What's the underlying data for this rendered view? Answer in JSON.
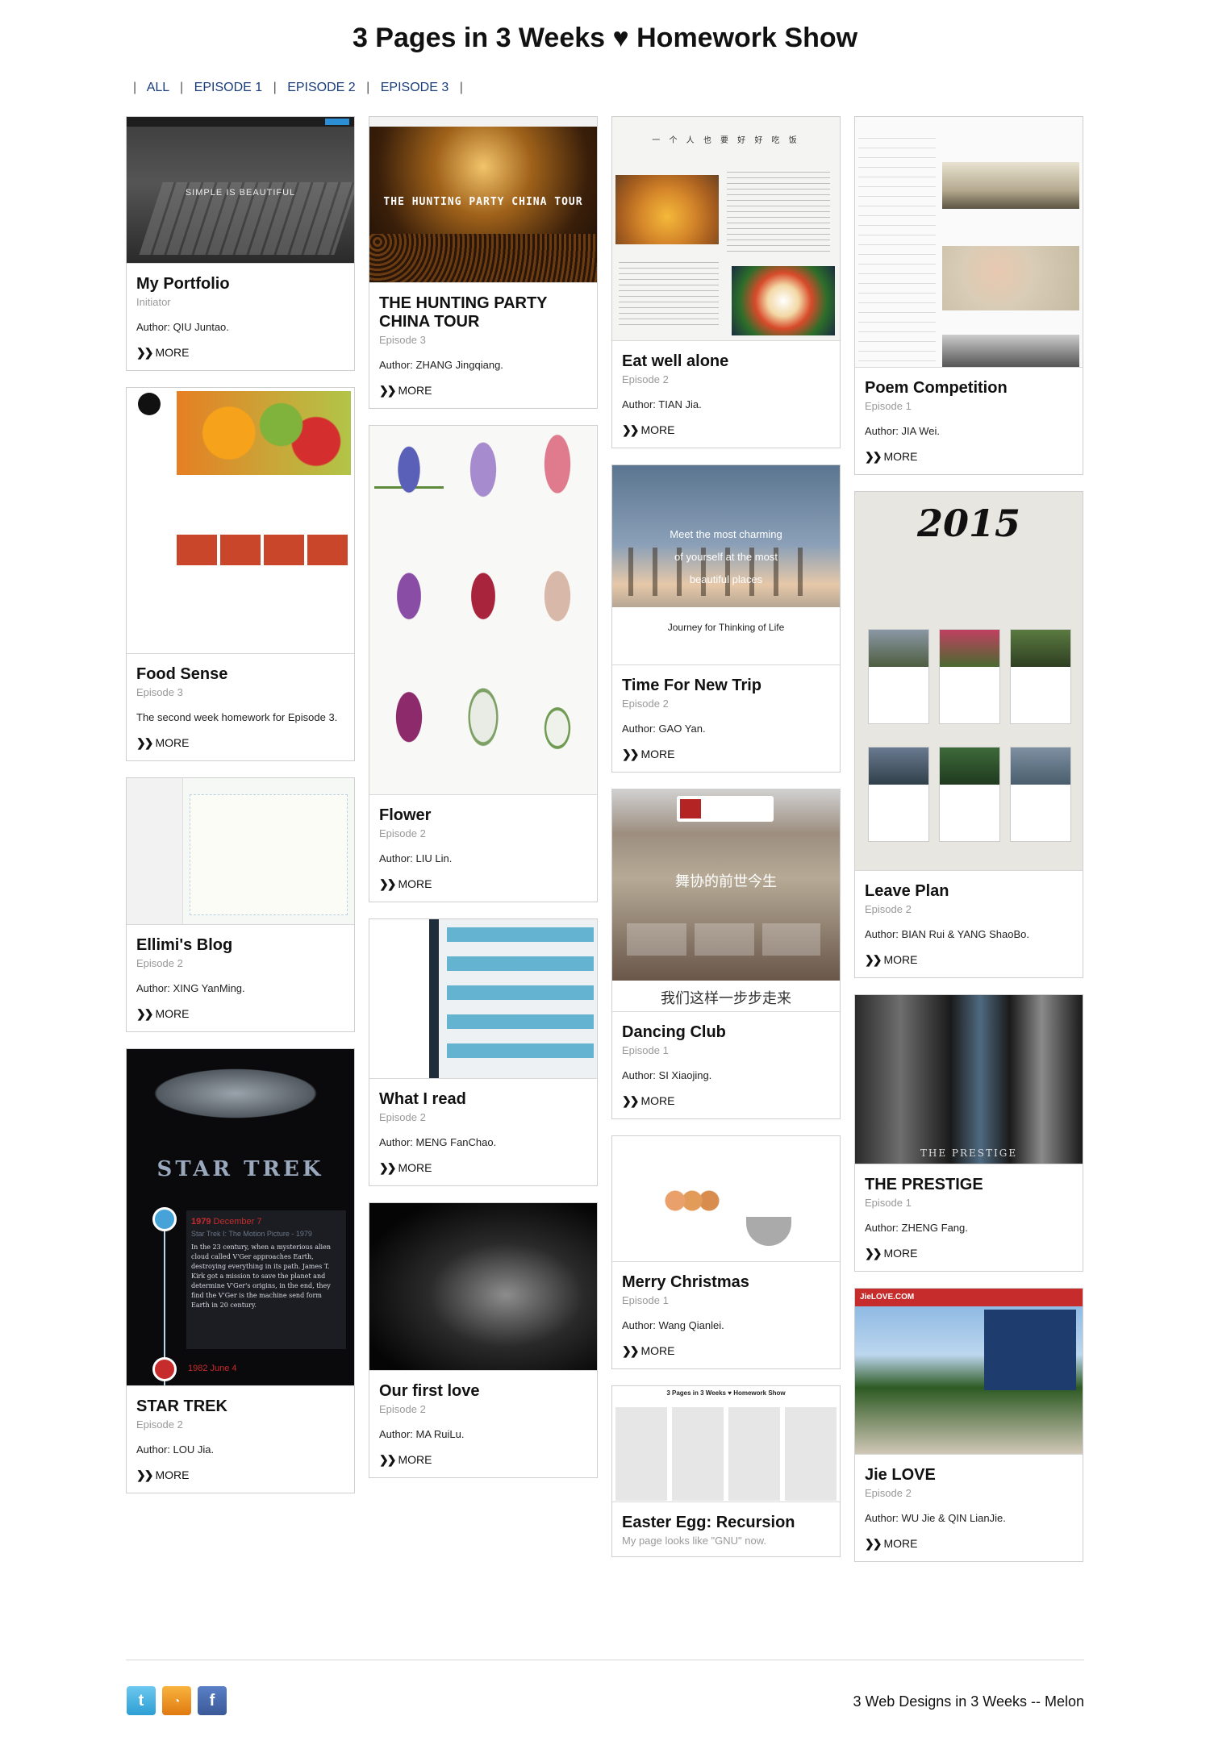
{
  "page": {
    "title": "3 Pages in 3 Weeks ♥ Homework Show"
  },
  "nav": {
    "items": [
      "ALL",
      "EPISODE 1",
      "EPISODE 2",
      "EPISODE 3"
    ],
    "separator": "|"
  },
  "more_label": "MORE",
  "cards": {
    "portfolio": {
      "title": "My Portfolio",
      "episode": "Initiator",
      "desc": "Author: QIU Juntao.",
      "thumb_text": "SIMPLE IS BEAUTIFUL"
    },
    "hunting": {
      "title": "THE HUNTING PARTY CHINA TOUR",
      "episode": "Episode 3",
      "desc": "Author: ZHANG Jingqiang.",
      "thumb_text": "THE HUNTING PARTY CHINA TOUR"
    },
    "eat": {
      "title": "Eat well alone",
      "episode": "Episode 2",
      "desc": "Author: TIAN Jia.",
      "thumb_text": "一 个 人 也 要 好 好 吃 饭"
    },
    "poem": {
      "title": "Poem Competition",
      "episode": "Episode 1",
      "desc": "Author: JIA Wei."
    },
    "food": {
      "title": "Food Sense",
      "episode": "Episode 3",
      "desc": "The second week homework for Episode 3."
    },
    "flower": {
      "title": "Flower",
      "episode": "Episode 2",
      "desc": "Author: LIU Lin."
    },
    "trip": {
      "title": "Time For New Trip",
      "episode": "Episode 2",
      "desc": "Author: GAO Yan.",
      "thumb_line1": "Meet the most charming",
      "thumb_line2": "of yourself at the most",
      "thumb_line3": "beautiful places",
      "thumb_sub": "Journey for Thinking of Life"
    },
    "leave": {
      "title": "Leave Plan",
      "episode": "Episode 2",
      "desc": "Author: BIAN Rui & YANG ShaoBo.",
      "thumb_year": "2015"
    },
    "ellimi": {
      "title": "Ellimi's Blog",
      "episode": "Episode 2",
      "desc": "Author: XING YanMing."
    },
    "whatread": {
      "title": "What I read",
      "episode": "Episode 2",
      "desc": "Author: MENG FanChao."
    },
    "dancing": {
      "title": "Dancing Club",
      "episode": "Episode 1",
      "desc": "Author: SI Xiaojing.",
      "thumb_head": "舞协的前世今生",
      "thumb_bottom": "我们这样一步步走来"
    },
    "prestige": {
      "title": "THE PRESTIGE",
      "episode": "Episode 1",
      "desc": "Author: ZHENG Fang.",
      "thumb_text": "THE PRESTIGE"
    },
    "startrek": {
      "title": "STAR TREK",
      "episode": "Episode 2",
      "desc": "Author: LOU Jia.",
      "thumb_logo": "STAR TREK",
      "date1_year": "1979",
      "date1_rest": " December 7",
      "film": "Star Trek I: The Motion Picture - 1979",
      "blurb": "In the 23 century, when a mysterious alien cloud called V'Ger approaches Earth, destroying everything in its path. James T. Kirk got a mission to save the planet and determine V'Ger's origins, in the end, they find the V'Ger is the machine send form Earth in 20 century.",
      "date2": "1982 June 4"
    },
    "firstlove": {
      "title": "Our first love",
      "episode": "Episode 2",
      "desc": "Author: MA RuiLu."
    },
    "christmas": {
      "title": "Merry Christmas",
      "episode": "Episode 1",
      "desc": "Author: Wang Qianlei."
    },
    "jie": {
      "title": "Jie LOVE",
      "episode": "Episode 2",
      "desc": "Author: WU Jie & QIN LianJie.",
      "thumb_text": "JieLOVE.COM"
    },
    "egg": {
      "title": "Easter Egg: Recursion",
      "episode": "My page looks like \"GNU\" now.",
      "thumb_text": "3 Pages in 3 Weeks ♥ Homework Show"
    }
  },
  "footer": {
    "text": "3 Web Designs in 3 Weeks -- Melon",
    "social": [
      "twitter-icon",
      "rss-icon",
      "facebook-icon"
    ]
  },
  "colors": {
    "nav_link": "#1a3d7a",
    "accent_red": "#c72c2c",
    "accent_blue": "#2d9fd4"
  }
}
